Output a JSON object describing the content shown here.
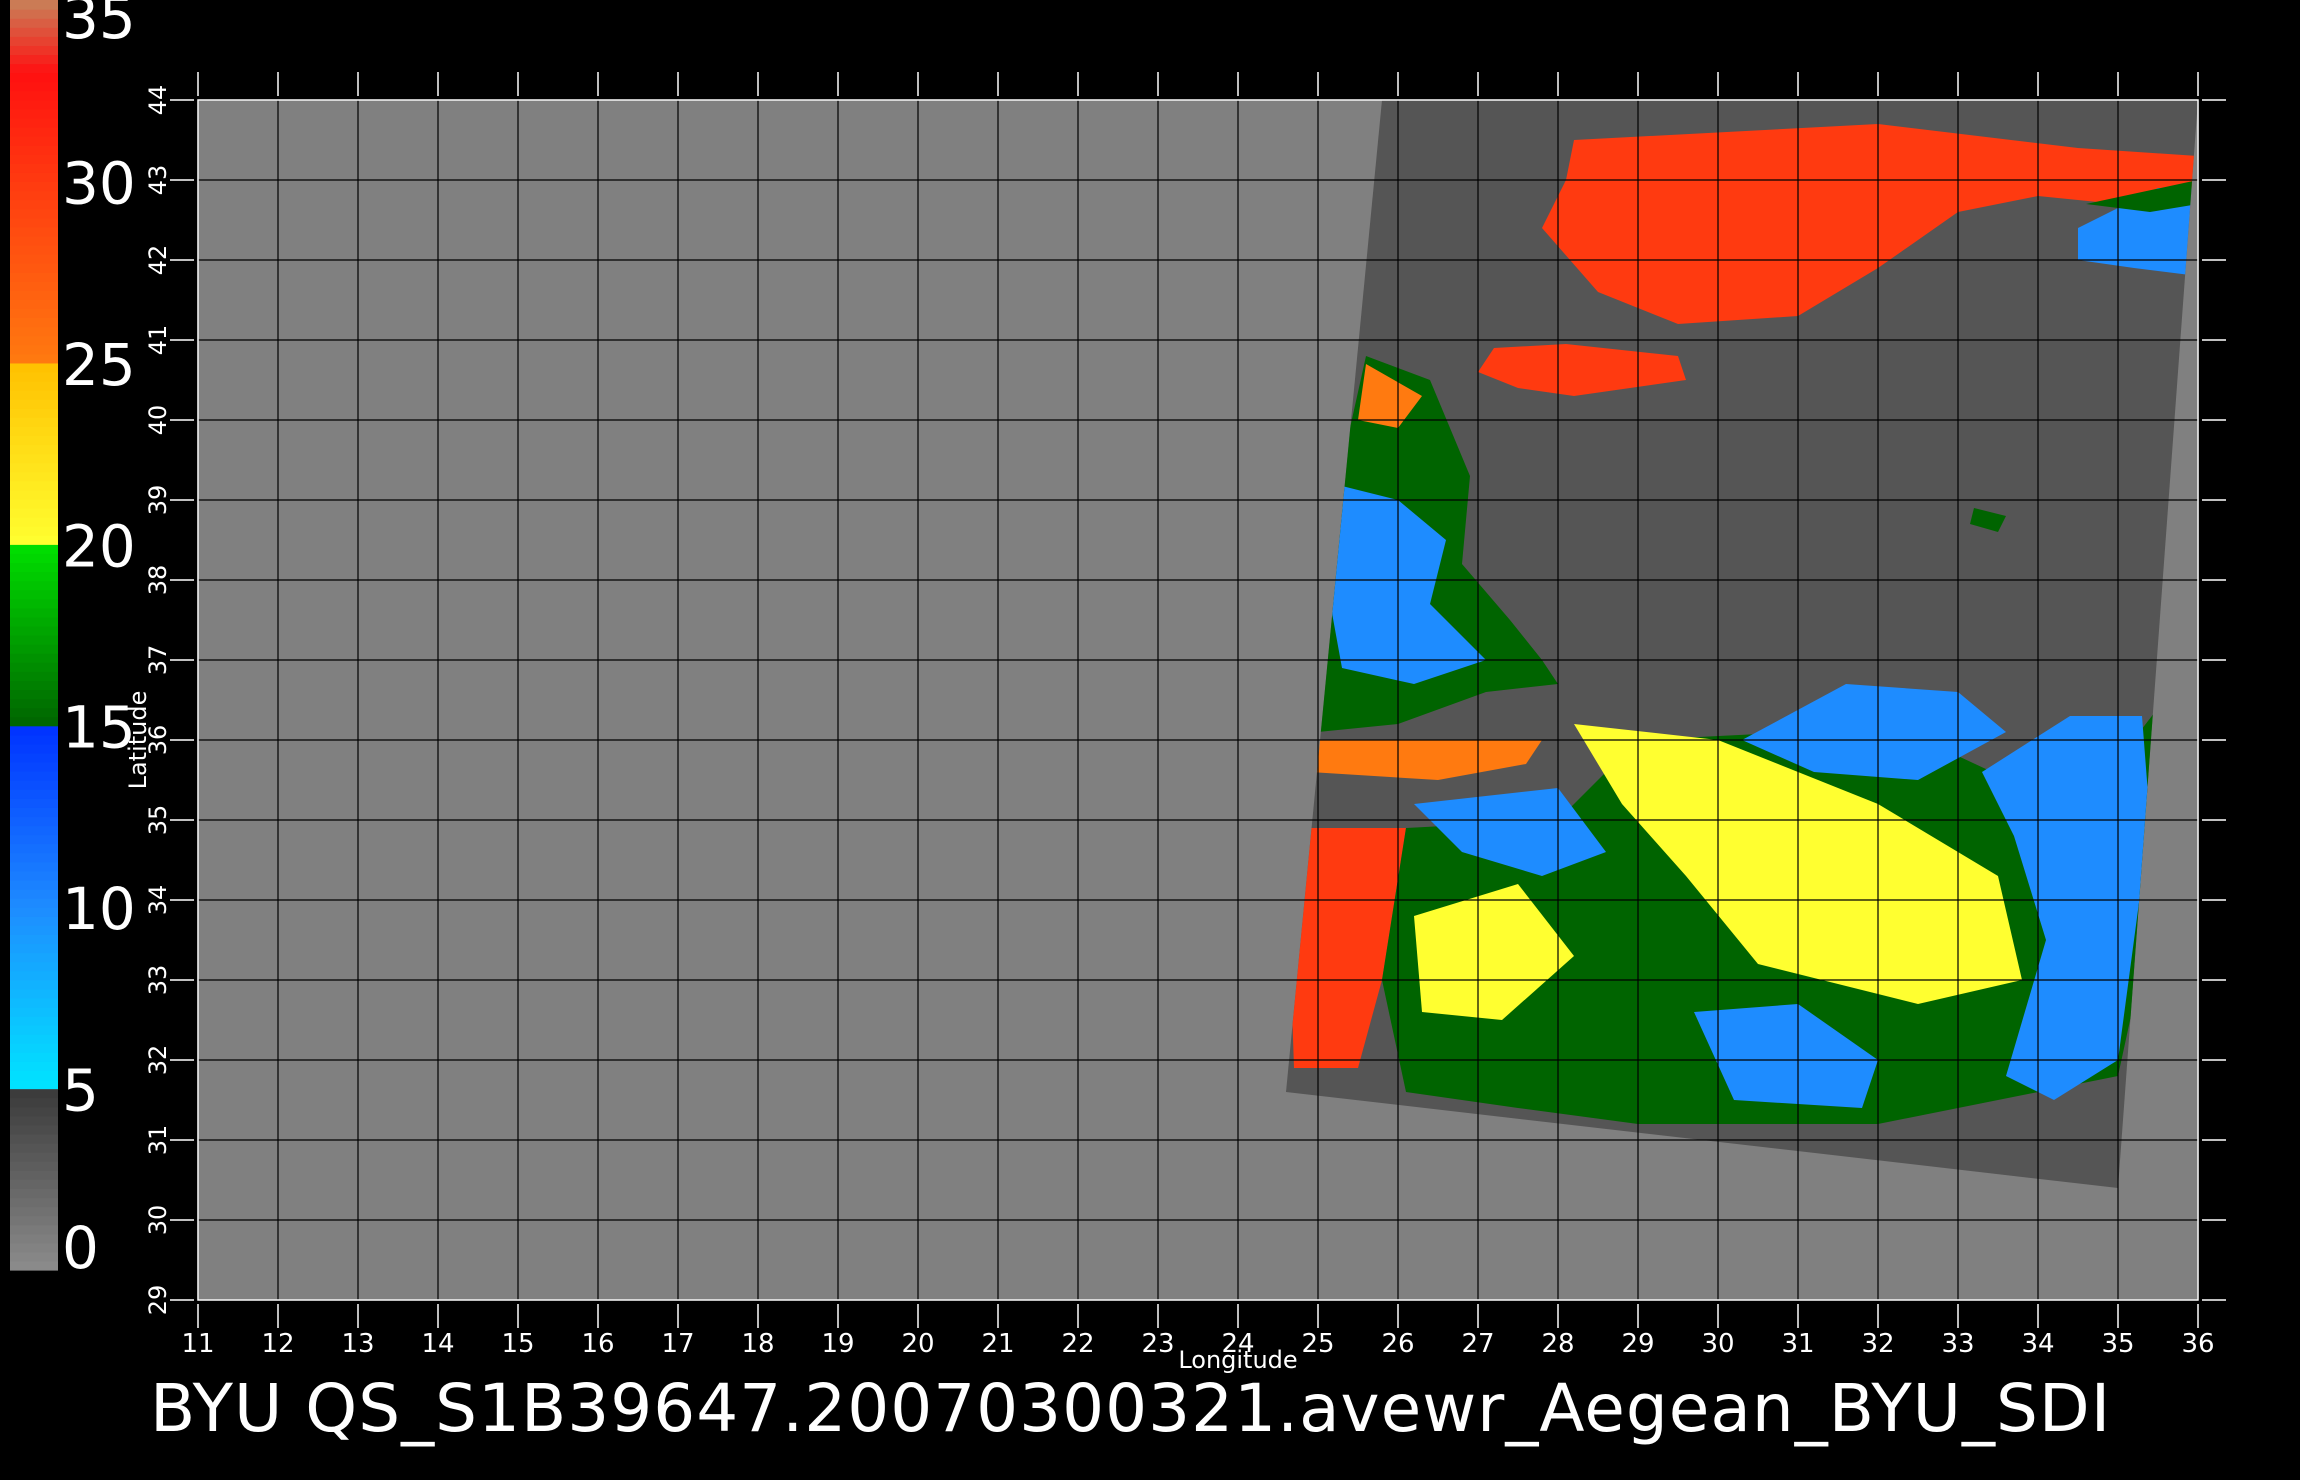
{
  "chart_data": {
    "type": "heatmap",
    "title": "",
    "caption": "BYU QS_S1B39647.20070300321.avewr_Aegean_BYU_SDI",
    "xlabel": "Longitude",
    "ylabel": "Latitude",
    "xlim": [
      11,
      36
    ],
    "ylim": [
      29,
      44
    ],
    "x_ticks": [
      "11",
      "12",
      "13",
      "14",
      "15",
      "16",
      "17",
      "18",
      "19",
      "20",
      "21",
      "22",
      "23",
      "24",
      "25",
      "26",
      "27",
      "28",
      "29",
      "30",
      "31",
      "32",
      "33",
      "34",
      "35",
      "36"
    ],
    "y_ticks": [
      "29",
      "30",
      "31",
      "32",
      "33",
      "34",
      "35",
      "36",
      "37",
      "38",
      "39",
      "40",
      "41",
      "42",
      "43",
      "44"
    ],
    "grid": true,
    "colorbar": {
      "placement": "left",
      "range": [
        0,
        35
      ],
      "tick_labels": [
        "0",
        "5",
        "10",
        "15",
        "20",
        "25",
        "30",
        "35"
      ],
      "stops": [
        {
          "value": 0,
          "color": "#8c8c8c"
        },
        {
          "value": 5,
          "color": "#3a3a3a"
        },
        {
          "value": 5.01,
          "color": "#00e5ff"
        },
        {
          "value": 10,
          "color": "#1e8cff"
        },
        {
          "value": 15,
          "color": "#0032ff"
        },
        {
          "value": 15.01,
          "color": "#006400"
        },
        {
          "value": 20,
          "color": "#00e000"
        },
        {
          "value": 20.01,
          "color": "#ffff30"
        },
        {
          "value": 25,
          "color": "#ffc000"
        },
        {
          "value": 25.01,
          "color": "#ff7a10"
        },
        {
          "value": 30,
          "color": "#ff3a10"
        },
        {
          "value": 33,
          "color": "#ff1010"
        },
        {
          "value": 35,
          "color": "#c8825a"
        }
      ]
    },
    "colors": {
      "background": "#000000",
      "plot_area": "#808080",
      "swath": "#555555",
      "grid": "#000000"
    },
    "swath_corners_lonlat": [
      [
        25.8,
        44
      ],
      [
        36,
        44
      ],
      [
        35,
        30.4
      ],
      [
        24.6,
        31.6
      ]
    ],
    "regions": [
      {
        "value": 31,
        "polygon": [
          [
            28.2,
            43.5
          ],
          [
            32,
            43.7
          ],
          [
            34.5,
            43.4
          ],
          [
            36,
            43.3
          ],
          [
            36,
            42.6
          ],
          [
            34,
            42.8
          ],
          [
            33,
            42.6
          ],
          [
            32,
            41.9
          ],
          [
            31,
            41.3
          ],
          [
            29.5,
            41.2
          ],
          [
            28.5,
            41.6
          ],
          [
            27.8,
            42.4
          ],
          [
            28.1,
            43.0
          ]
        ]
      },
      {
        "value": 13,
        "polygon": [
          [
            34.5,
            42.4
          ],
          [
            35.5,
            42.9
          ],
          [
            36,
            42.9
          ],
          [
            36,
            41.8
          ],
          [
            35.2,
            41.9
          ],
          [
            34.5,
            42.0
          ]
        ]
      },
      {
        "value": 17,
        "polygon": [
          [
            34.6,
            42.7
          ],
          [
            36,
            43.0
          ],
          [
            36,
            42.7
          ],
          [
            35.4,
            42.6
          ]
        ]
      },
      {
        "value": 30,
        "polygon": [
          [
            27.2,
            40.9
          ],
          [
            28.1,
            40.95
          ],
          [
            29.5,
            40.8
          ],
          [
            29.6,
            40.5
          ],
          [
            28.2,
            40.3
          ],
          [
            27.5,
            40.4
          ],
          [
            27.0,
            40.6
          ]
        ]
      },
      {
        "value": 18,
        "polygon": [
          [
            25.6,
            40.8
          ],
          [
            26.4,
            40.5
          ],
          [
            26.9,
            39.3
          ],
          [
            26.8,
            38.2
          ],
          [
            27.4,
            37.5
          ],
          [
            27.8,
            37.0
          ],
          [
            28.0,
            36.7
          ],
          [
            27.1,
            36.6
          ],
          [
            26.0,
            36.2
          ],
          [
            25.0,
            36.1
          ],
          [
            24.9,
            37.5
          ],
          [
            25.2,
            39.0
          ]
        ]
      },
      {
        "value": 12,
        "polygon": [
          [
            25.2,
            39.2
          ],
          [
            26.0,
            39.0
          ],
          [
            26.6,
            38.5
          ],
          [
            26.4,
            37.7
          ],
          [
            27.1,
            37.0
          ],
          [
            26.2,
            36.7
          ],
          [
            25.3,
            36.9
          ],
          [
            25.1,
            38.0
          ]
        ]
      },
      {
        "value": 27,
        "polygon": [
          [
            25.6,
            40.7
          ],
          [
            26.3,
            40.3
          ],
          [
            26.0,
            39.9
          ],
          [
            25.5,
            40.0
          ]
        ]
      },
      {
        "value": 28,
        "polygon": [
          [
            24.9,
            36.0
          ],
          [
            27.8,
            36.0
          ],
          [
            27.6,
            35.7
          ],
          [
            26.5,
            35.5
          ],
          [
            24.9,
            35.6
          ]
        ]
      },
      {
        "value": 30,
        "polygon": [
          [
            24.6,
            34.9
          ],
          [
            26.1,
            34.9
          ],
          [
            25.8,
            33.0
          ],
          [
            25.5,
            31.9
          ],
          [
            24.7,
            31.9
          ]
        ]
      },
      {
        "value": 17,
        "polygon": [
          [
            26.1,
            34.9
          ],
          [
            28.0,
            35.0
          ],
          [
            29.0,
            36.0
          ],
          [
            31.0,
            36.1
          ],
          [
            33.0,
            35.8
          ],
          [
            34.5,
            35.1
          ],
          [
            35.5,
            36.4
          ],
          [
            35.8,
            35.5
          ],
          [
            35.0,
            31.8
          ],
          [
            32.0,
            31.2
          ],
          [
            29.0,
            31.2
          ],
          [
            27.5,
            31.4
          ],
          [
            26.1,
            31.6
          ],
          [
            25.8,
            33.0
          ]
        ]
      },
      {
        "value": 23,
        "polygon": [
          [
            28.2,
            36.2
          ],
          [
            30.0,
            36.0
          ],
          [
            32.0,
            35.2
          ],
          [
            33.5,
            34.3
          ],
          [
            33.8,
            33.0
          ],
          [
            32.5,
            32.7
          ],
          [
            30.5,
            33.2
          ],
          [
            29.6,
            34.3
          ],
          [
            28.8,
            35.2
          ]
        ]
      },
      {
        "value": 22,
        "polygon": [
          [
            26.2,
            33.8
          ],
          [
            27.5,
            34.2
          ],
          [
            28.2,
            33.3
          ],
          [
            27.3,
            32.5
          ],
          [
            26.3,
            32.6
          ]
        ]
      },
      {
        "value": 14,
        "polygon": [
          [
            30.3,
            36.0
          ],
          [
            31.6,
            36.7
          ],
          [
            33.0,
            36.6
          ],
          [
            33.6,
            36.1
          ],
          [
            32.5,
            35.5
          ],
          [
            31.2,
            35.6
          ]
        ]
      },
      {
        "value": 13,
        "polygon": [
          [
            33.3,
            35.6
          ],
          [
            34.4,
            36.3
          ],
          [
            35.3,
            36.3
          ],
          [
            35.4,
            35.0
          ],
          [
            35.0,
            32.0
          ],
          [
            34.2,
            31.5
          ],
          [
            33.6,
            31.8
          ],
          [
            34.1,
            33.5
          ],
          [
            33.7,
            34.8
          ]
        ]
      },
      {
        "value": 13,
        "polygon": [
          [
            29.7,
            32.6
          ],
          [
            31.0,
            32.7
          ],
          [
            32.0,
            32.0
          ],
          [
            31.8,
            31.4
          ],
          [
            30.2,
            31.5
          ]
        ]
      },
      {
        "value": 13,
        "polygon": [
          [
            26.2,
            35.2
          ],
          [
            28.0,
            35.4
          ],
          [
            28.6,
            34.6
          ],
          [
            27.8,
            34.3
          ],
          [
            26.8,
            34.6
          ]
        ]
      },
      {
        "value": 19,
        "polygon": [
          [
            33.2,
            38.9
          ],
          [
            33.6,
            38.8
          ],
          [
            33.5,
            38.6
          ],
          [
            33.15,
            38.7
          ]
        ]
      }
    ]
  }
}
